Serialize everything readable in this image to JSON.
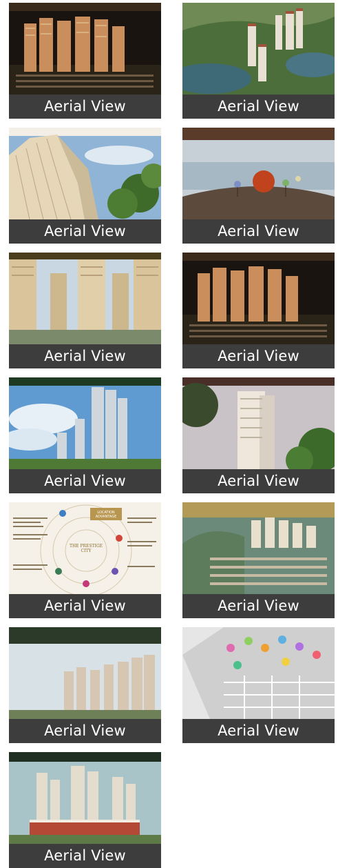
{
  "gallery": {
    "tiles": [
      {
        "caption": "Aerial View",
        "image": "night-aerial-towers"
      },
      {
        "caption": "Aerial View",
        "image": "towers-by-lake"
      },
      {
        "caption": "Aerial View",
        "image": "looking-up-towers"
      },
      {
        "caption": "Aerial View",
        "image": "lake-amenity-deck"
      },
      {
        "caption": "Aerial View",
        "image": "central-plaza-towers"
      },
      {
        "caption": "Aerial View",
        "image": "night-aerial-towers-2"
      },
      {
        "caption": "Aerial View",
        "image": "towers-blue-sky"
      },
      {
        "caption": "Aerial View",
        "image": "tower-with-trees"
      },
      {
        "caption": "Aerial View",
        "image": "location-advantage-map"
      },
      {
        "caption": "Aerial View",
        "image": "aerial-township"
      },
      {
        "caption": "Aerial View",
        "image": "skyline-towers"
      },
      {
        "caption": "Aerial View",
        "image": "master-site-plan"
      },
      {
        "caption": "Aerial View",
        "image": "clubhouse-towers"
      }
    ]
  },
  "location_map": {
    "title": "LOCATION ADVANTAGE",
    "brand": "THE PRESTIGE CITY"
  }
}
